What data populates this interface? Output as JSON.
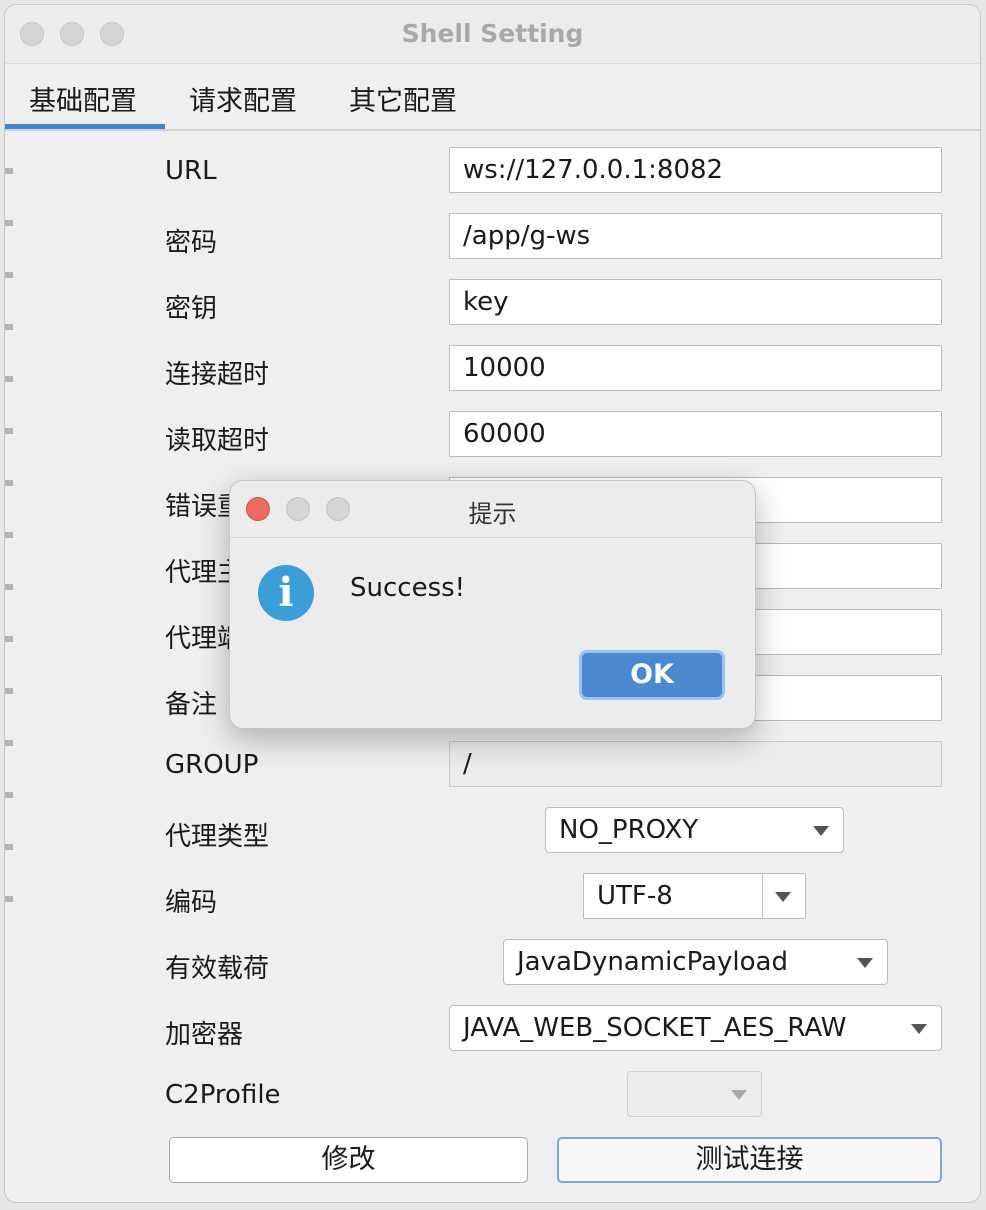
{
  "window": {
    "title": "Shell Setting"
  },
  "tabs": [
    {
      "label": "基础配置",
      "active": true
    },
    {
      "label": "请求配置",
      "active": false
    },
    {
      "label": "其它配置",
      "active": false
    }
  ],
  "form": {
    "url": {
      "label": "URL",
      "value": "ws://127.0.0.1:8082"
    },
    "password": {
      "label": "密码",
      "value": "/app/g-ws"
    },
    "key": {
      "label": "密钥",
      "value": "key"
    },
    "connect_timeout": {
      "label": "连接超时",
      "value": "10000"
    },
    "read_timeout": {
      "label": "读取超时",
      "value": "60000"
    },
    "retry_label_visible": "错误重",
    "proxy_host_label_visible": "代理主",
    "proxy_port_label_visible": "代理端",
    "remark_label": "备注",
    "group": {
      "label": "GROUP",
      "value": "/"
    },
    "proxy_type": {
      "label": "代理类型",
      "value": "NO_PROXY"
    },
    "encoding": {
      "label": "编码",
      "value": "UTF-8"
    },
    "payload": {
      "label": "有效载荷",
      "value": "JavaDynamicPayload"
    },
    "cryption": {
      "label": "加密器",
      "value": "JAVA_WEB_SOCKET_AES_RAW"
    },
    "c2profile": {
      "label": "C2Profile",
      "value": ""
    }
  },
  "buttons": {
    "modify": "修改",
    "test_connection": "测试连接"
  },
  "dialog": {
    "title": "提示",
    "message": "Success!",
    "icon": "info-icon",
    "ok_label": "OK"
  },
  "colors": {
    "accent": "#3d84d9",
    "ok_button": "#4a88cf",
    "info_icon": "#3a9fd9",
    "close_red": "#ec6a5e"
  }
}
